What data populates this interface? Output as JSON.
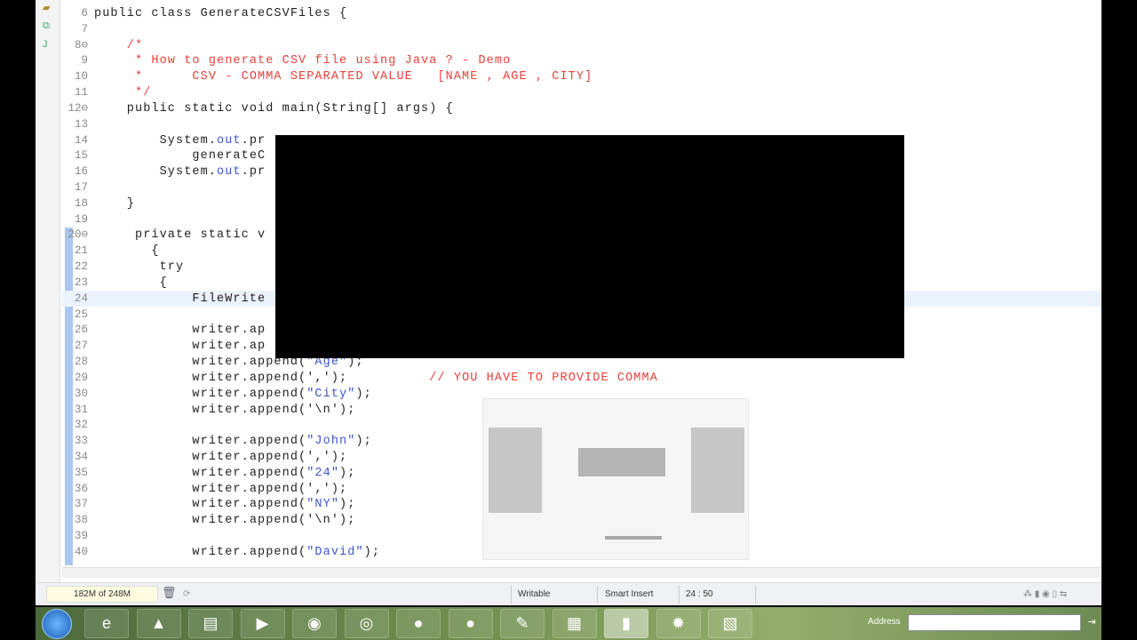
{
  "editor": {
    "lines": [
      {
        "n": "6",
        "segs": [
          {
            "t": "public class GenerateCSVFiles {"
          }
        ]
      },
      {
        "n": "7",
        "segs": []
      },
      {
        "n": "8⊖",
        "segs": [
          {
            "t": "    /*",
            "c": "cm"
          }
        ]
      },
      {
        "n": "9",
        "segs": [
          {
            "t": "     * How to generate CSV file using Java ? - Demo",
            "c": "cm"
          }
        ]
      },
      {
        "n": "10",
        "segs": [
          {
            "t": "     *      CSV - COMMA SEPARATED VALUE   [NAME , AGE , CITY]",
            "c": "cm"
          }
        ]
      },
      {
        "n": "11",
        "segs": [
          {
            "t": "     */",
            "c": "cm"
          }
        ]
      },
      {
        "n": "12⊖",
        "segs": [
          {
            "t": "    public static void main(String[] args) {"
          }
        ]
      },
      {
        "n": "13",
        "segs": []
      },
      {
        "n": "14",
        "segs": [
          {
            "t": "        System."
          },
          {
            "t": "out",
            "c": "fld"
          },
          {
            "t": ".pr"
          }
        ]
      },
      {
        "n": "15",
        "segs": [
          {
            "t": "            generateC"
          }
        ]
      },
      {
        "n": "16",
        "segs": [
          {
            "t": "        System."
          },
          {
            "t": "out",
            "c": "fld"
          },
          {
            "t": ".pr"
          }
        ]
      },
      {
        "n": "17",
        "segs": []
      },
      {
        "n": "18",
        "segs": [
          {
            "t": "    }"
          }
        ]
      },
      {
        "n": "19",
        "segs": []
      },
      {
        "n": "20⊖",
        "segs": [
          {
            "t": "     private static v"
          }
        ]
      },
      {
        "n": "21",
        "segs": [
          {
            "t": "       {"
          }
        ]
      },
      {
        "n": "22",
        "segs": [
          {
            "t": "        try"
          }
        ]
      },
      {
        "n": "23",
        "segs": [
          {
            "t": "        {"
          }
        ]
      },
      {
        "n": "24",
        "current": true,
        "segs": [
          {
            "t": "            FileWrite"
          }
        ]
      },
      {
        "n": "25",
        "segs": []
      },
      {
        "n": "26",
        "segs": [
          {
            "t": "            writer.ap"
          }
        ]
      },
      {
        "n": "27",
        "segs": [
          {
            "t": "            writer.ap"
          }
        ]
      },
      {
        "n": "28",
        "segs": [
          {
            "t": "            writer.append("
          },
          {
            "t": "\"Age\"",
            "c": "str"
          },
          {
            "t": ");"
          }
        ]
      },
      {
        "n": "29",
        "segs": [
          {
            "t": "            writer.append(',');          "
          },
          {
            "t": "// YOU HAVE TO PROVIDE COMMA",
            "c": "cm"
          }
        ]
      },
      {
        "n": "30",
        "segs": [
          {
            "t": "            writer.append("
          },
          {
            "t": "\"City\"",
            "c": "str"
          },
          {
            "t": ");"
          }
        ]
      },
      {
        "n": "31",
        "segs": [
          {
            "t": "            writer.append('\\n');"
          }
        ]
      },
      {
        "n": "32",
        "segs": []
      },
      {
        "n": "33",
        "segs": [
          {
            "t": "            writer.append("
          },
          {
            "t": "\"John\"",
            "c": "str"
          },
          {
            "t": ");"
          }
        ]
      },
      {
        "n": "34",
        "segs": [
          {
            "t": "            writer.append(',');"
          }
        ]
      },
      {
        "n": "35",
        "segs": [
          {
            "t": "            writer.append("
          },
          {
            "t": "\"24\"",
            "c": "str"
          },
          {
            "t": ");"
          }
        ]
      },
      {
        "n": "36",
        "segs": [
          {
            "t": "            writer.append(',');"
          }
        ]
      },
      {
        "n": "37",
        "segs": [
          {
            "t": "            writer.append("
          },
          {
            "t": "\"NY\"",
            "c": "str"
          },
          {
            "t": ");"
          }
        ]
      },
      {
        "n": "38",
        "segs": [
          {
            "t": "            writer.append('\\n');"
          }
        ]
      },
      {
        "n": "39",
        "segs": []
      },
      {
        "n": "40",
        "segs": [
          {
            "t": "            writer.append("
          },
          {
            "t": "\"David\"",
            "c": "str"
          },
          {
            "t": ");"
          }
        ]
      }
    ]
  },
  "status": {
    "heap": "182M of 248M",
    "writable": "Writable",
    "insert_mode": "Smart Insert",
    "position": "24 : 50"
  },
  "taskbar": {
    "apps": [
      {
        "name": "internet-explorer",
        "glyph": "e"
      },
      {
        "name": "vlc",
        "glyph": "▲"
      },
      {
        "name": "file-explorer",
        "glyph": "▤"
      },
      {
        "name": "media-player",
        "glyph": "▶"
      },
      {
        "name": "firefox",
        "glyph": "◉"
      },
      {
        "name": "chrome",
        "glyph": "◎"
      },
      {
        "name": "app-orange-1",
        "glyph": "●"
      },
      {
        "name": "app-orange-2",
        "glyph": "●"
      },
      {
        "name": "app-red",
        "glyph": "✎"
      },
      {
        "name": "paint",
        "glyph": "▦"
      },
      {
        "name": "recorder",
        "glyph": "▮",
        "active": true
      },
      {
        "name": "eclipse",
        "glyph": "✹"
      },
      {
        "name": "app-green",
        "glyph": "▧"
      }
    ],
    "address_label": "Address"
  },
  "colors": {
    "comment": "#e8403a",
    "field": "#3c55c8"
  }
}
